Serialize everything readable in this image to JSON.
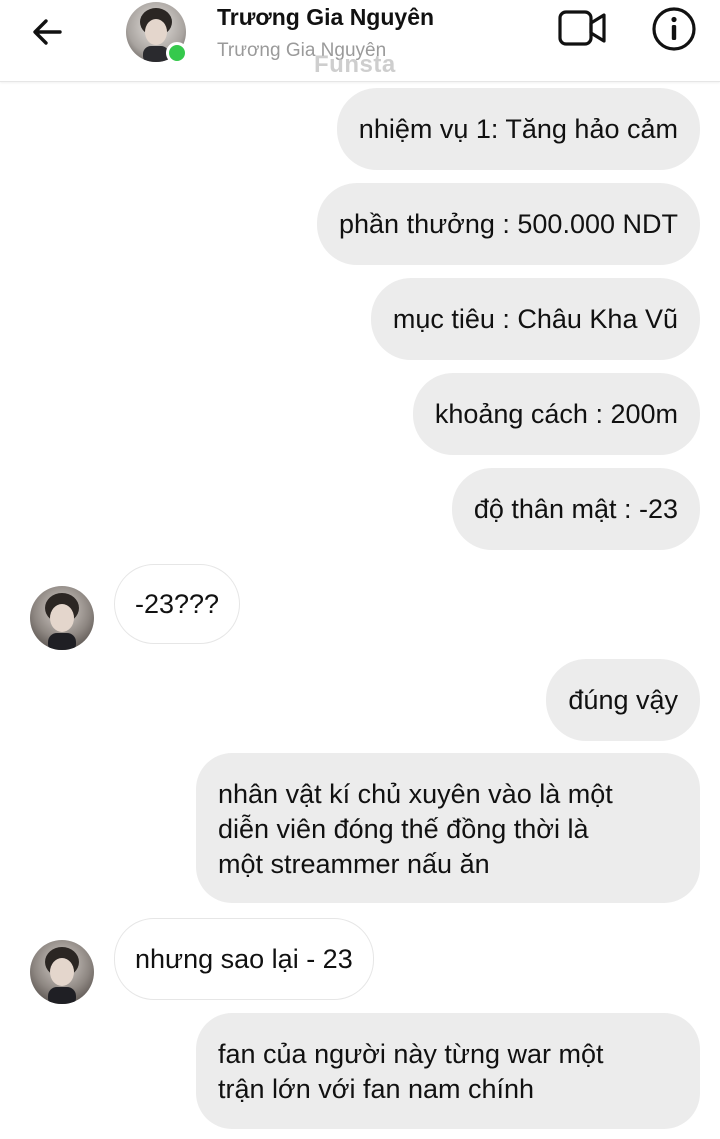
{
  "header": {
    "name": "Trương Gia Nguyên",
    "subtitle": "Trương Gia Nguyên",
    "watermark": "Funsta",
    "back_icon": "arrow-left-icon",
    "video_icon": "video-camera-icon",
    "info_icon": "info-icon",
    "online_color": "#35c94c"
  },
  "messages": [
    {
      "side": "out",
      "text": "nhiệm vụ 1: Tăng hảo cảm"
    },
    {
      "side": "out",
      "text": "phần thưởng : 500.000 NDT"
    },
    {
      "side": "out",
      "text": "mục tiêu : Châu Kha Vũ"
    },
    {
      "side": "out",
      "text": "khoảng cách : 200m"
    },
    {
      "side": "out",
      "text": "độ thân mật : -23"
    },
    {
      "side": "in",
      "text": "-23???"
    },
    {
      "side": "out",
      "text": "đúng vậy"
    },
    {
      "side": "out",
      "lines": [
        "nhân vật kí chủ xuyên vào là một",
        "diễn viên đóng thế đồng thời là",
        "một streammer nấu ăn"
      ]
    },
    {
      "side": "in",
      "text": "nhưng sao lại - 23"
    },
    {
      "side": "out",
      "lines": [
        "fan của người này từng war một",
        "trận lớn với fan nam chính"
      ]
    }
  ],
  "colors": {
    "outgoing_bubble": "#ececec",
    "incoming_bubble": "#ffffff",
    "text": "#111111"
  }
}
